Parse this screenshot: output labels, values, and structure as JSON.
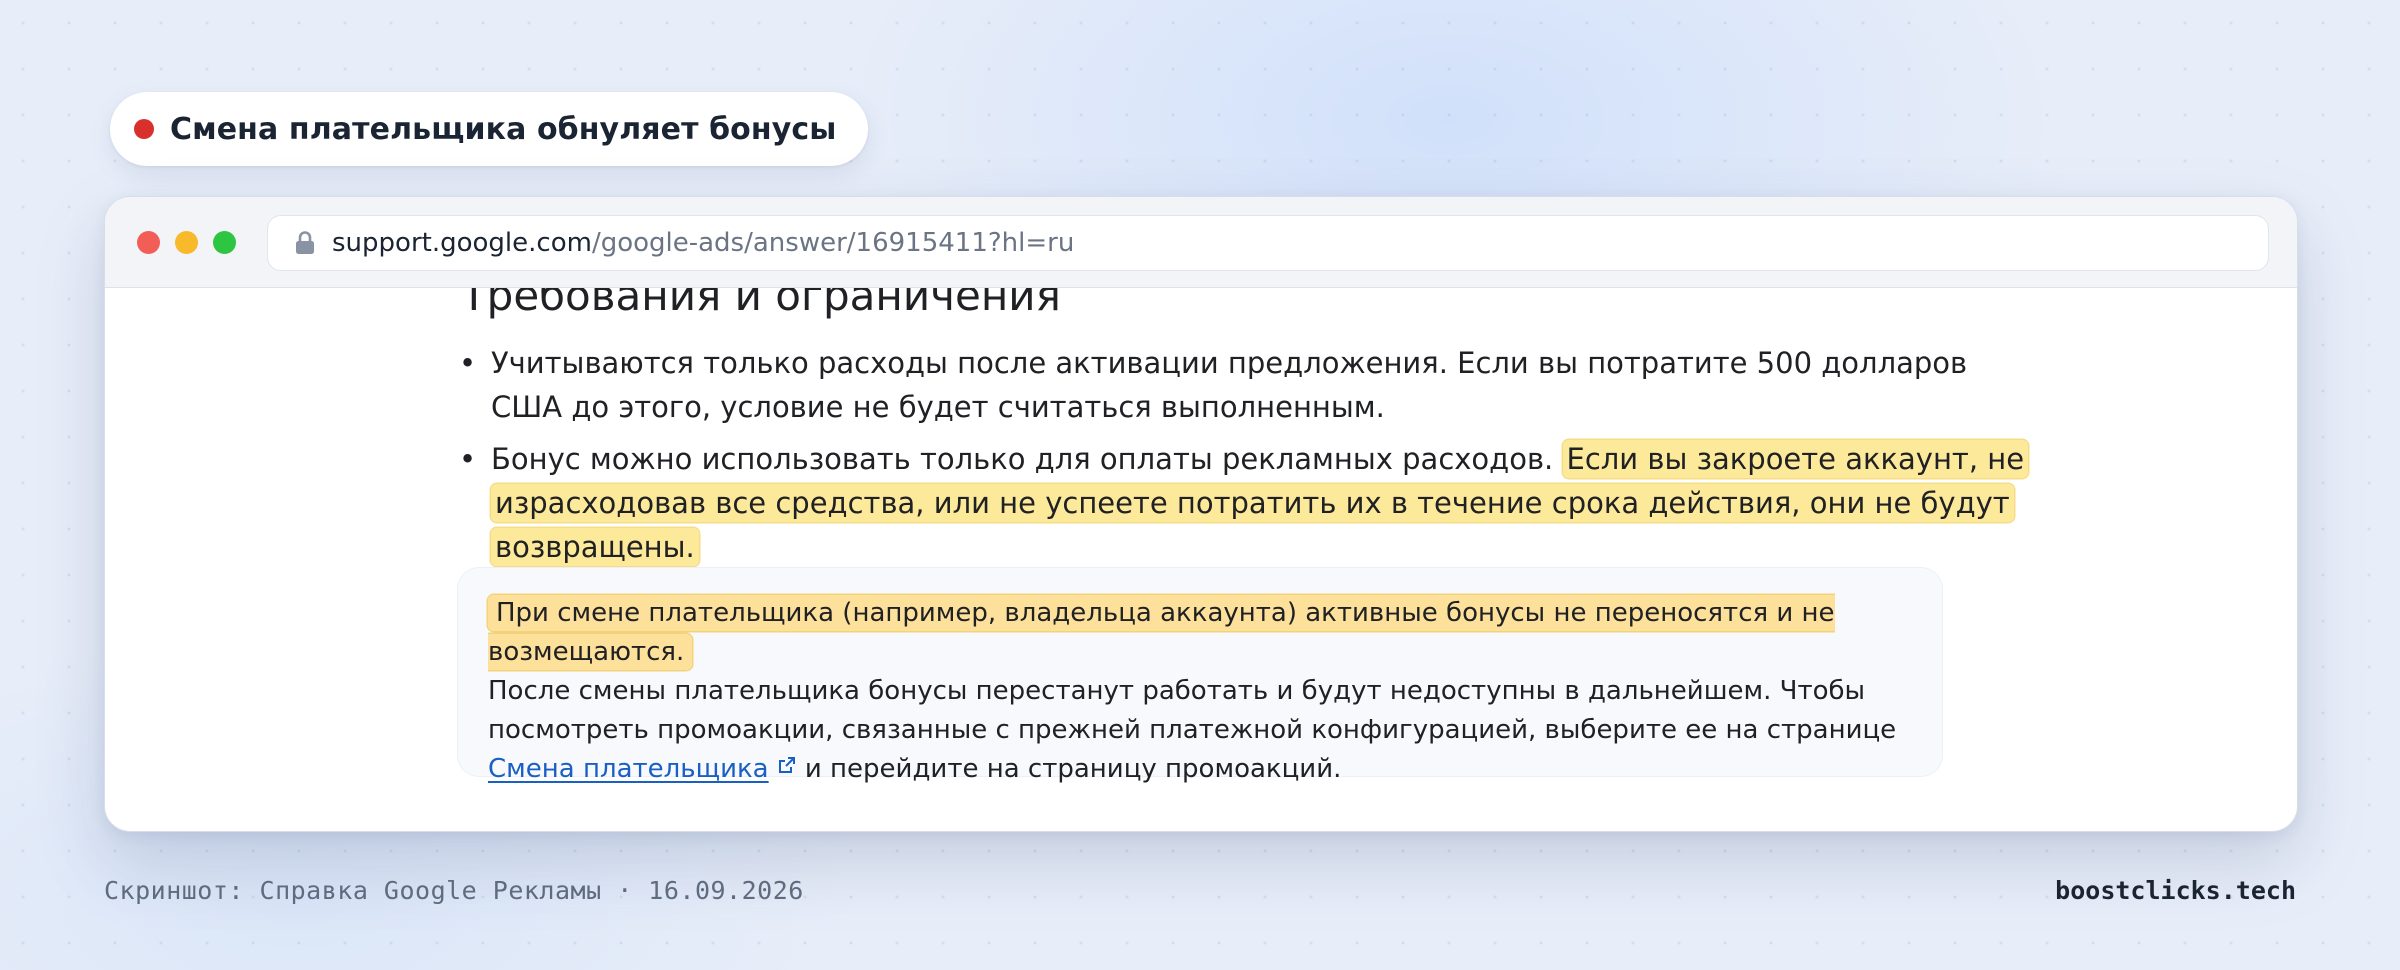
{
  "badge": {
    "text": "Смена плательщика обнуляет бонусы",
    "dot_color": "#d9302c"
  },
  "browser": {
    "url_domain": "support.google.com",
    "url_path": "/google-ads/answer/16915411?hl=ru",
    "url_icon": "lock-icon"
  },
  "article": {
    "heading": "Требования и ограничения",
    "bullets": [
      {
        "text": "Учитываются только расходы после активации предложения. Если вы потратите 500 долларов США до этого, условие не будет считаться выполненным."
      },
      {
        "text": "Бонус можно использовать только для оплаты рекламных расходов.",
        "highlight": "Если вы закроете аккаунт, не израсходовав все средства, или не успеете потратить их в течение срока действия, они не будут возвращены."
      }
    ],
    "note": {
      "highlight": "При смене плательщика (например, владельца аккаунта) активные бонусы не переносятся и не возмещаются.",
      "text_before_link": "После смены плательщика бонусы перестанут работать и будут недоступны в дальнейшем. Чтобы посмотреть промоакции, связанные с прежней платежной конфигурацией, выберите ее на странице",
      "link_text": "Смена плательщика",
      "link_icon": "external-link-icon",
      "text_after_link": "и перейдите на страницу промоакций."
    },
    "highlight_color": "#fde99a"
  },
  "footer": {
    "caption": "Скриншот: Справка Google Рекламы · 16.09.2026",
    "site": "boostclicks.tech"
  }
}
